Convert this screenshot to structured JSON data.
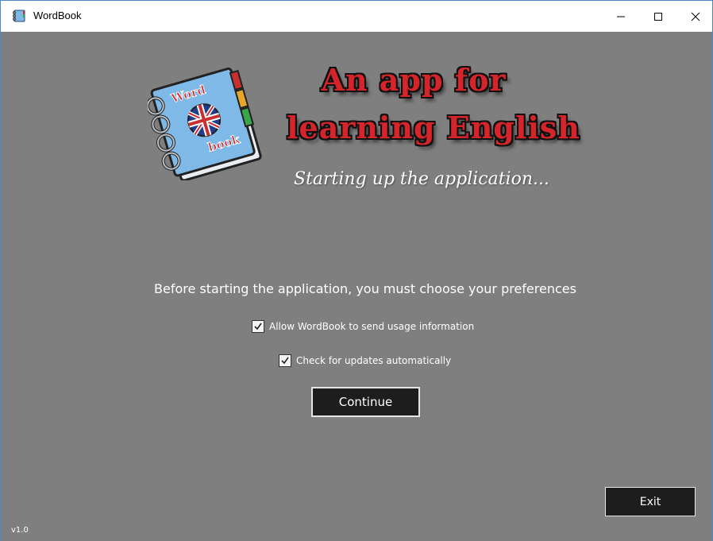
{
  "window": {
    "title": "WordBook",
    "controls": {
      "minimize": "minimize",
      "maximize": "maximize",
      "close": "close"
    }
  },
  "logo": {
    "book_word_top": "Word",
    "book_word_bottom": "book",
    "headline_line1": "An app for",
    "headline_line2": "learning English",
    "subtitle": "Starting up the application..."
  },
  "preferences": {
    "heading": "Before starting the application, you must choose your preferences",
    "options": [
      {
        "label": "Allow WordBook to send usage information",
        "checked": true
      },
      {
        "label": "Check for updates automatically",
        "checked": true
      }
    ],
    "continue_label": "Continue"
  },
  "footer": {
    "exit_label": "Exit",
    "version": "v1.0"
  },
  "colors": {
    "background": "#7f7f7f",
    "headline_red": "#d6242b",
    "button_dark": "#1d1d1d",
    "book_blue": "#7fb9e8"
  }
}
